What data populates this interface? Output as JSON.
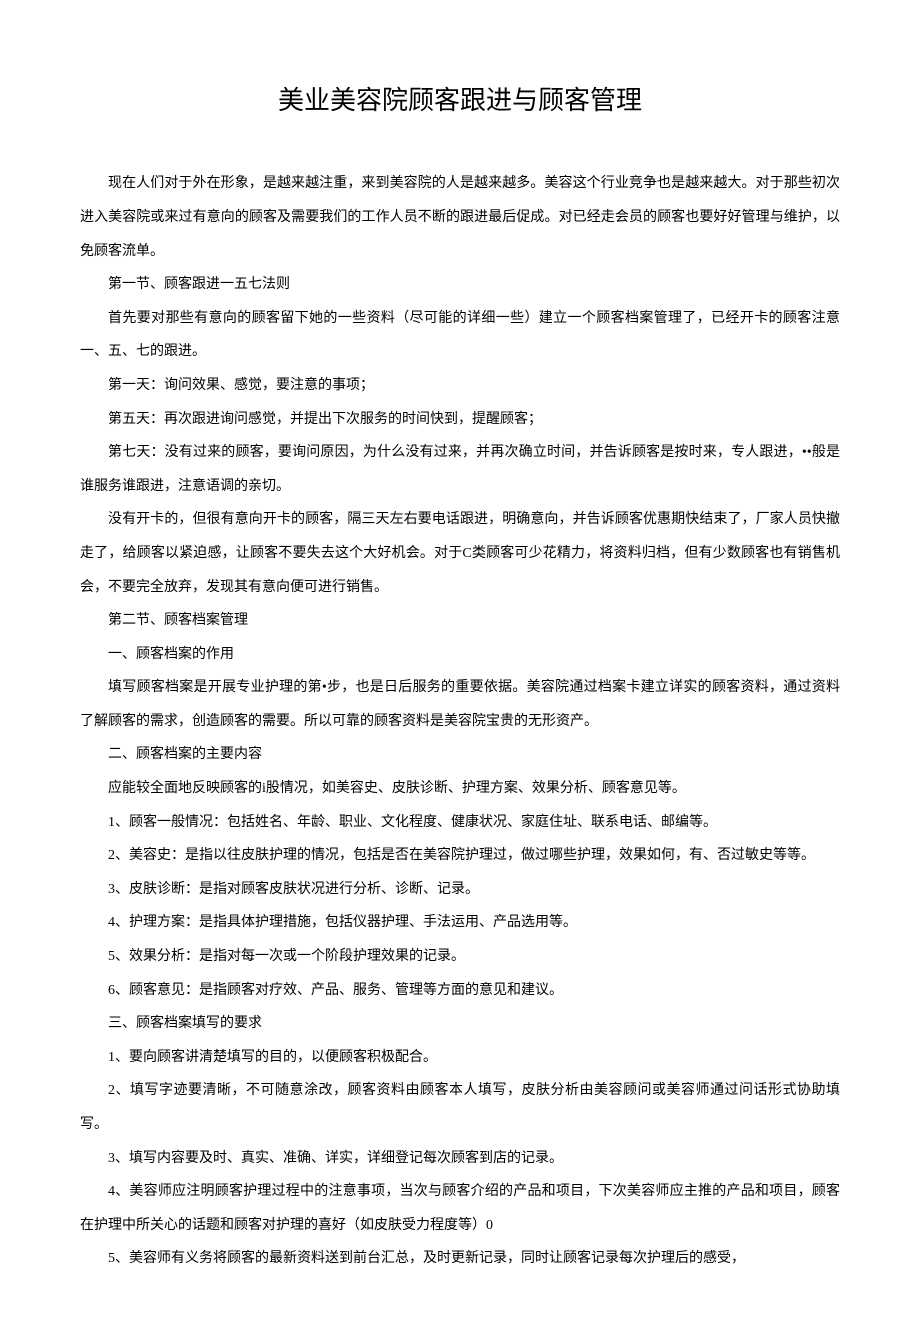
{
  "title": "美业美容院顾客跟进与顾客管理",
  "paragraphs": [
    "现在人们对于外在形象，是越来越注重，来到美容院的人是越来越多。美容这个行业竞争也是越来越大。对于那些初次进入美容院或来过有意向的顾客及需要我们的工作人员不断的跟进最后促成。对已经走会员的顾客也要好好管理与维护，以免顾客流单。",
    "第一节、顾客跟进一五七法则",
    "首先要对那些有意向的顾客留下她的一些资料（尽可能的详细一些）建立一个顾客档案管理了，已经开卡的顾客注意一、五、七的跟进。",
    "第一天：询问效果、感觉，要注意的事项；",
    "第五天：再次跟进询问感觉，并提出下次服务的时间快到，提醒顾客；",
    "第七天：没有过来的顾客，要询问原因，为什么没有过来，并再次确立时间，并告诉顾客是按时来，专人跟进，••般是谁服务谁跟进，注意语调的亲切。",
    "没有开卡的，但很有意向开卡的顾客，隔三天左右要电话跟进，明确意向，并告诉顾客优惠期快结束了，厂家人员快撤走了，给顾客以紧迫感，让顾客不要失去这个大好机会。对于C类顾客可少花精力，将资料归档，但有少数顾客也有销售机会，不要完全放弃，发现其有意向便可进行销售。",
    "第二节、顾客档案管理",
    "一、顾客档案的作用",
    "填写顾客档案是开展专业护理的第•步，也是日后服务的重要依据。美容院通过档案卡建立详实的顾客资料，通过资料了解顾客的需求，创造顾客的需要。所以可靠的顾客资料是美容院宝贵的无形资产。",
    "二、顾客档案的主要内容",
    "应能较全面地反映顾客的i股情况，如美容史、皮肤诊断、护理方案、效果分析、顾客意见等。",
    "1、顾客一般情况：包括姓名、年龄、职业、文化程度、健康状况、家庭住址、联系电话、邮编等。",
    "2、美容史：是指以往皮肤护理的情况，包括是否在美容院护理过，做过哪些护理，效果如何，有、否过敏史等等。",
    "3、皮肤诊断：是指对顾客皮肤状况进行分析、诊断、记录。",
    "4、护理方案：是指具体护理措施，包括仪器护理、手法运用、产品选用等。",
    "5、效果分析：是指对每一次或一个阶段护理效果的记录。",
    "6、顾客意见：是指顾客对疗效、产品、服务、管理等方面的意见和建议。",
    "三、顾客档案填写的要求",
    "1、要向顾客讲清楚填写的目的，以便顾客积极配合。",
    "2、填写字迹要清晰，不可随意涂改，顾客资料由顾客本人填写，皮肤分析由美容顾问或美容师通过问话形式协助填写。",
    "3、填写内容要及时、真实、准确、详实，详细登记每次顾客到店的记录。",
    "4、美容师应注明顾客护理过程中的注意事项，当次与顾客介绍的产品和项目，下次美容师应主推的产品和项目，顾客在护理中所关心的话题和顾客对护理的喜好（如皮肤受力程度等）0",
    "5、美容师有义务将顾客的最新资料送到前台汇总，及时更新记录，同时让顾客记录每次护理后的感受，"
  ]
}
